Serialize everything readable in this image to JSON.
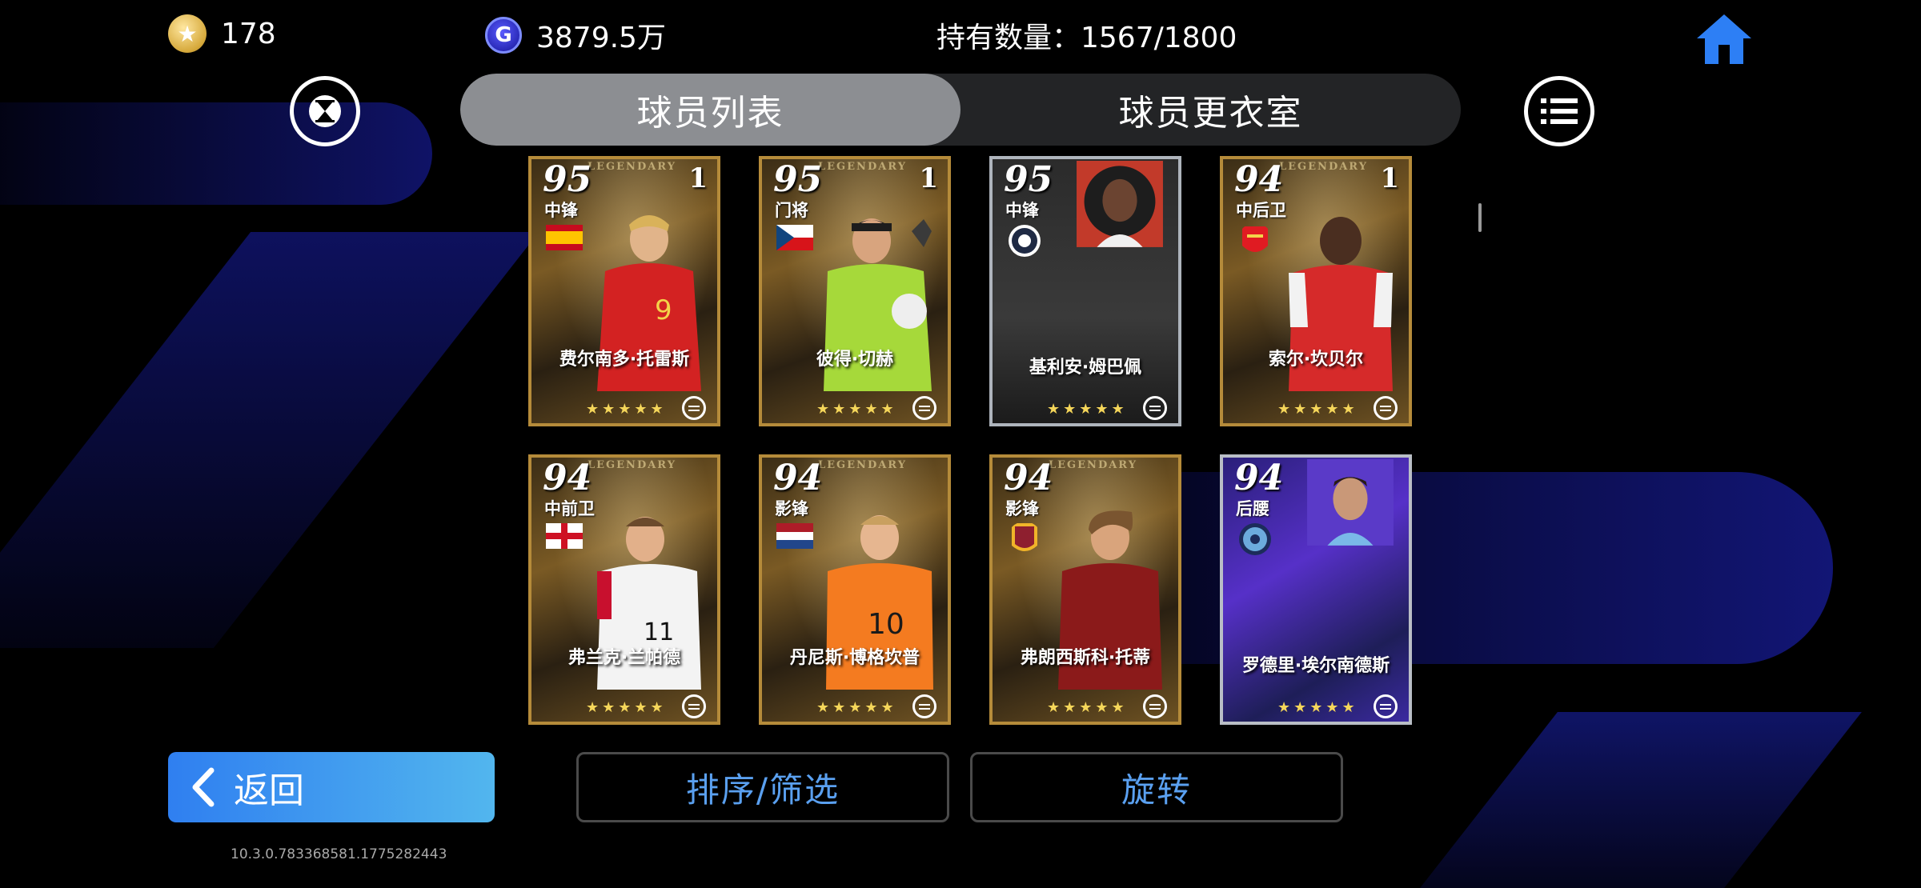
{
  "topbar": {
    "coins": "178",
    "gp": "3879.5万",
    "holdings": "持有数量：1567/1800",
    "coin_icon": "star-coin-icon",
    "gp_icon": "gp-icon",
    "home_icon": "home-icon"
  },
  "tabs": [
    {
      "label": "球员列表",
      "active": true
    },
    {
      "label": "球员更衣室",
      "active": false
    }
  ],
  "cards": [
    {
      "rating": "95",
      "count": "1",
      "position": "中锋",
      "name": "费尔南多·托雷斯",
      "legendary": "LEGENDARY",
      "stars": "★★★★★"
    },
    {
      "rating": "95",
      "count": "1",
      "position": "门将",
      "name": "彼得·切赫",
      "legendary": "LEGENDARY",
      "stars": "★★★★★"
    },
    {
      "rating": "95",
      "count": "",
      "position": "中锋",
      "name": "基利安·姆巴佩",
      "legendary": "",
      "stars": "★★★★★"
    },
    {
      "rating": "94",
      "count": "1",
      "position": "中后卫",
      "name": "索尔·坎贝尔",
      "legendary": "LEGENDARY",
      "stars": "★★★★★"
    },
    {
      "rating": "94",
      "count": "",
      "position": "中前卫",
      "name": "弗兰克·兰帕德",
      "legendary": "LEGENDARY",
      "stars": "★★★★★"
    },
    {
      "rating": "94",
      "count": "",
      "position": "影锋",
      "name": "丹尼斯·博格坎普",
      "legendary": "LEGENDARY",
      "stars": "★★★★★"
    },
    {
      "rating": "94",
      "count": "",
      "position": "影锋",
      "name": "弗朗西斯科·托蒂",
      "legendary": "LEGENDARY",
      "stars": "★★★★★"
    },
    {
      "rating": "94",
      "count": "",
      "position": "后腰",
      "name": "罗德里·埃尔南德斯",
      "legendary": "",
      "stars": "★★★★★"
    }
  ],
  "bottom": {
    "back_label": "返回",
    "sort_label": "排序/筛选",
    "rotate_label": "旋转",
    "version": "10.3.0.783368581.1775282443"
  },
  "colors": {
    "accent_blue": "#2f7ff0",
    "button_text_blue": "#5aa0f0",
    "gold_border": "#b58b3a",
    "tab_active": "#8c8e92",
    "tab_bg": "#232426"
  }
}
